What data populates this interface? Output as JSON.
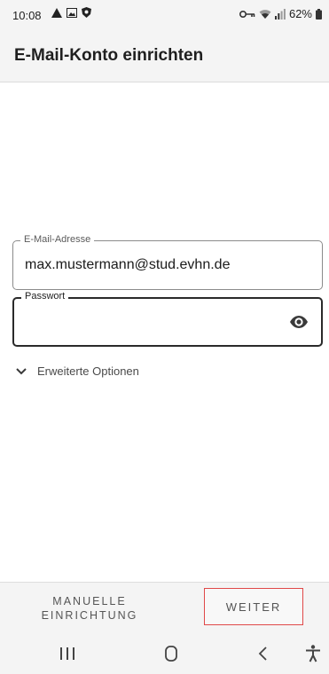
{
  "status_bar": {
    "time": "10:08",
    "battery": "62%",
    "icons": [
      "alert-icon",
      "image-icon",
      "shield-icon",
      "vpn-key-icon",
      "wifi-icon",
      "signal-icon",
      "battery-icon"
    ]
  },
  "app_bar": {
    "title": "E-Mail-Konto einrichten"
  },
  "form": {
    "email": {
      "label": "E-Mail-Adresse",
      "value": "max.mustermann@stud.evhn.de"
    },
    "password": {
      "label": "Passwort",
      "value": ""
    },
    "advanced": {
      "label": "Erweiterte Optionen"
    }
  },
  "actions": {
    "manual_line1": "MANUELLE",
    "manual_line2": "EINRICHTUNG",
    "next": "WEITER"
  },
  "nav": {
    "icons": [
      "recents-icon",
      "home-icon",
      "back-icon",
      "accessibility-icon"
    ]
  },
  "colors": {
    "highlight_border": "#e04848",
    "focused_border": "#2a2a2a",
    "bar_background": "#f4f4f4"
  }
}
